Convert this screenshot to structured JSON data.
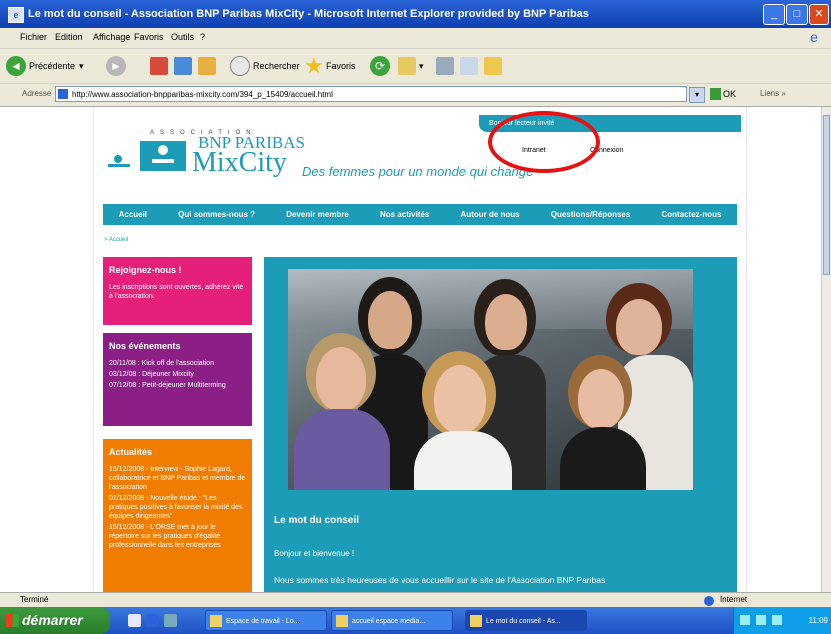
{
  "window": {
    "title": "Le mot du conseil - Association BNP Paribas MixCity - Microsoft Internet Explorer provided by BNP Paribas"
  },
  "menubar": {
    "items": [
      "Fichier",
      "Edition",
      "Affichage",
      "Favoris",
      "Outils",
      "?"
    ]
  },
  "toolbar": {
    "back_label": "Précédente",
    "search_label": "Rechercher",
    "favorites_label": "Favoris"
  },
  "addressbar": {
    "label": "Adresse",
    "url": "http://www.association-bnpparibas-mixcity.com/394_p_15409/accueil.html",
    "go_label": "OK",
    "links_label": "Liens"
  },
  "site": {
    "welcome": "Bonjour lecteur invité",
    "intranet_link": "Intranet",
    "login_link": "Connexion",
    "logo_association": "ASSOCIATION",
    "logo_bnp": "BNP PARIBAS",
    "logo_mixcity": "MixCity",
    "tagline": "Des femmes pour un monde qui change",
    "nav": [
      "Accueil",
      "Qui sommes-nous ?",
      "Devenir membre",
      "Nos activités",
      "Autour de nous",
      "Questions/Réponses",
      "Contactez-nous"
    ],
    "breadcrumb": "> Accueil",
    "sidebar": {
      "rejoignez_title": "Rejoignez-nous !",
      "rejoignez_text": "Les inscriptions sont ouvertes, adhérez vite à l'association.",
      "events_title": "Nos événements",
      "events": [
        "20/11/08 : Kick off de l'association",
        "03/12/08 : Déjeuner Mixcity",
        "07/12/08 : Petit-déjeuner Multiterming"
      ],
      "news_title": "Actualités",
      "news": [
        "15/12/2008 - Interview - Sophie Lagard, collaboratrice et BNP Paribas et membre de l'association",
        "01/12/2008 - Nouvelle étude : \"Les pratiques positives à favoriser la mixité des équipes dirigeantes\"",
        "15/12/2008 - L'ORSE met à jour le répertoire sur les pratiques d'égalité professionnelle dans les entreprises"
      ]
    },
    "main": {
      "title": "Le mot du conseil",
      "greeting": "Bonjour et bienvenue !",
      "intro": "Nous sommes très heureuses de vous accueillir sur le site de l'Association BNP Paribas"
    }
  },
  "statusbar": {
    "status": "Terminé",
    "zone": "Internet"
  },
  "taskbar": {
    "start_label": "démarrer",
    "tasks": [
      "Espace de travail - Lo...",
      "accueil espace media...",
      "Le mot du conseil - As..."
    ],
    "clock": "11:09"
  },
  "colors": {
    "brand_teal": "#1c9cb6",
    "rejoignez_pink": "#e5207a",
    "events_purple": "#8c1f86",
    "news_orange": "#f07d00",
    "annotation_red": "#e81010"
  }
}
